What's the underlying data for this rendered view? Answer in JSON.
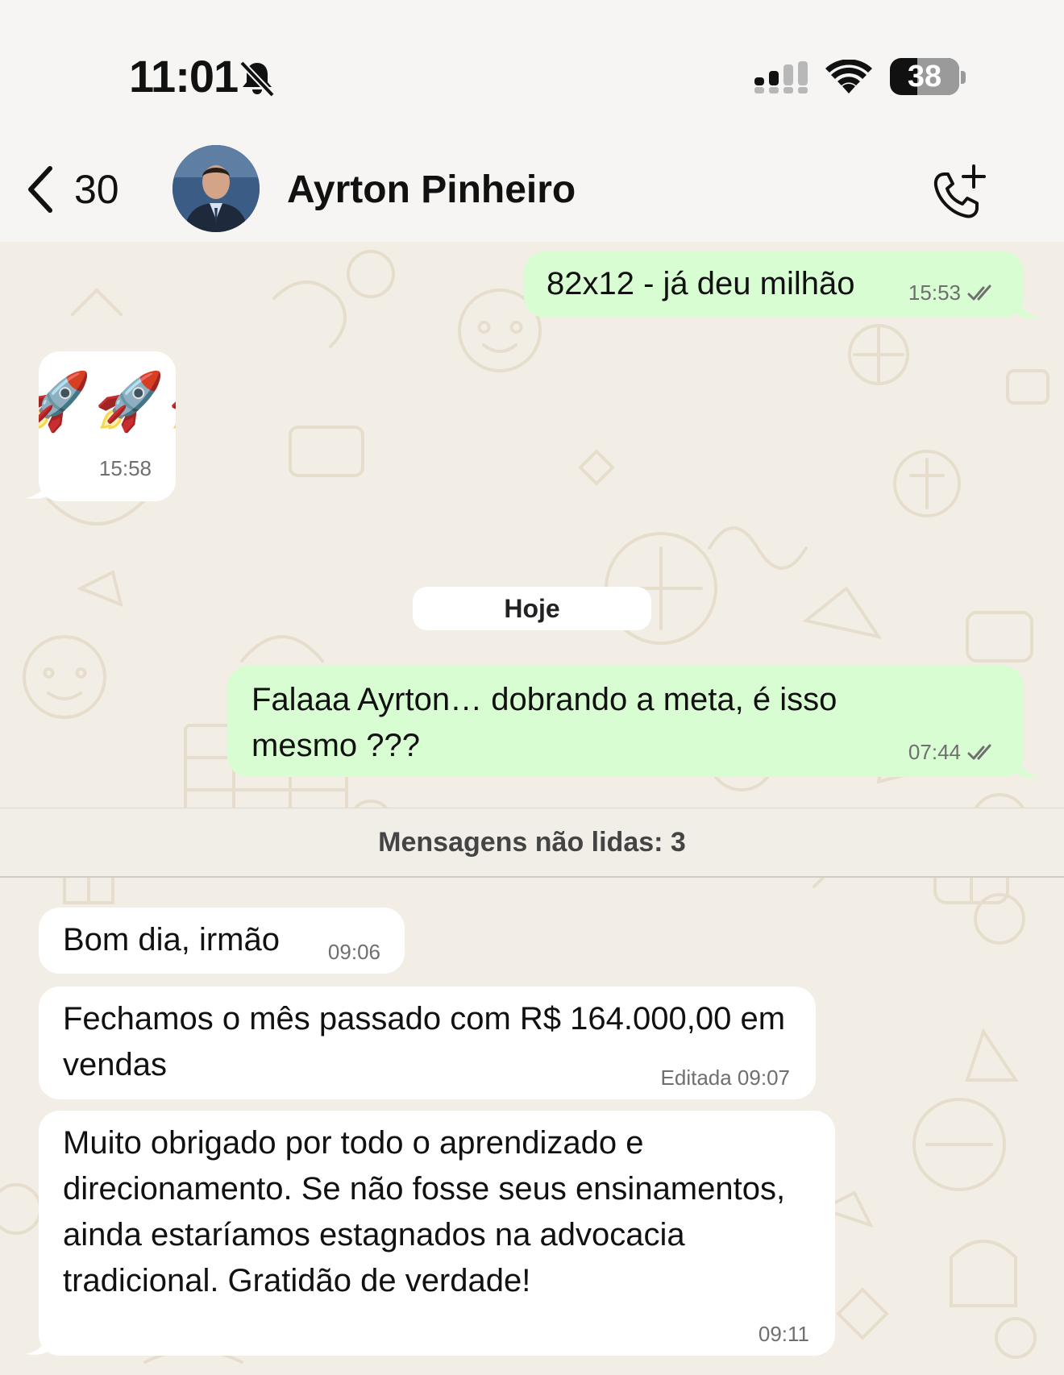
{
  "status_bar": {
    "time": "11:01",
    "battery": "38",
    "icons": [
      "bell-slash-icon",
      "cellular-signal-icon",
      "wifi-icon",
      "battery-icon"
    ]
  },
  "header": {
    "back_count": "30",
    "contact_name": "Ayrton Pinheiro",
    "icons": [
      "chevron-left-icon",
      "add-call-icon"
    ]
  },
  "messages": [
    {
      "direction": "out",
      "text": "82x12 - já deu milhão",
      "time": "15:53",
      "status": "read"
    },
    {
      "direction": "in",
      "type": "emoji",
      "text": "🚀🚀🚀",
      "time": "15:58"
    },
    {
      "direction": "out",
      "text": "Falaaa Ayrton… dobrando a meta, é isso mesmo ???",
      "time": "07:44",
      "status": "read"
    },
    {
      "direction": "in",
      "text": "Bom dia, irmão",
      "time": "09:06"
    },
    {
      "direction": "in",
      "text": "Fechamos o mês passado com R$ 164.000,00 em vendas",
      "time": "Editada 09:07"
    },
    {
      "direction": "in",
      "text": "Muito obrigado por todo o aprendizado e direcionamento. Se não fosse seus ensinamentos, ainda estaríamos estagnados na advocacia tradicional. Gratidão de verdade!",
      "time": "09:11"
    }
  ],
  "day_separator": "Hoje",
  "unread_separator": "Mensagens não lidas: 3",
  "colors": {
    "outgoing_bubble": "#D9FDD3",
    "incoming_bubble": "#FFFFFF",
    "chat_background": "#F3EEE5",
    "header_background": "#F6F5F3"
  }
}
